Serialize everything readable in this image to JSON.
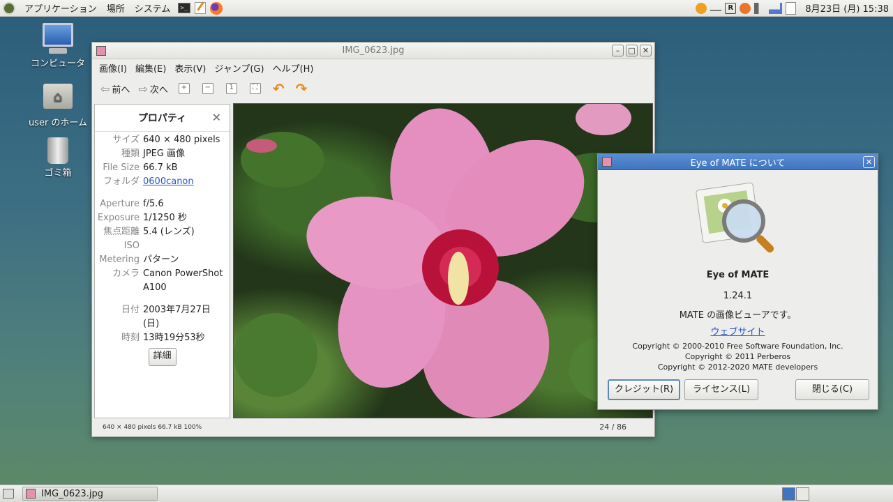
{
  "top_panel": {
    "menus": [
      "アプリケーション",
      "場所",
      "システム"
    ],
    "clock": "8月23日 (月) 15:38",
    "tray_icons": [
      "update-icon",
      "minimize-icon",
      "r-icon",
      "settings-icon",
      "volume-icon",
      "network-icon",
      "clipboard-icon"
    ]
  },
  "desktop": {
    "icons": [
      {
        "label": "コンピュータ"
      },
      {
        "label": "user のホーム"
      },
      {
        "label": "ゴミ箱"
      }
    ]
  },
  "viewer": {
    "title": "IMG_0623.jpg",
    "menu": [
      "画像(I)",
      "編集(E)",
      "表示(V)",
      "ジャンプ(G)",
      "ヘルプ(H)"
    ],
    "toolbar": {
      "prev": "前へ",
      "next": "次へ"
    },
    "sidebar": {
      "title": "プロパティ",
      "rows": [
        {
          "k": "サイズ",
          "v": "640 × 480 pixels"
        },
        {
          "k": "種類",
          "v": "JPEG 画像"
        },
        {
          "k": "File Size",
          "v": "66.7 kB"
        },
        {
          "k": "フォルダ",
          "v": "0600canon"
        },
        {
          "k": "Aperture",
          "v": "f/5.6"
        },
        {
          "k": "Exposure",
          "v": "1/1250 秒"
        },
        {
          "k": "焦点距離",
          "v": "5.4 (レンズ)"
        },
        {
          "k": "ISO",
          "v": ""
        },
        {
          "k": "Metering",
          "v": "パターン"
        },
        {
          "k": "カメラ",
          "v": "Canon PowerShot A100"
        },
        {
          "k": "日付",
          "v": "2003年7月27日 (日)"
        },
        {
          "k": "時刻",
          "v": "13時19分53秒"
        }
      ],
      "details_button": "詳細"
    },
    "status": {
      "left": "640 × 480 pixels  66.7 kB   100%",
      "right": "24 / 86"
    }
  },
  "about": {
    "title": "Eye of MATE について",
    "name": "Eye of MATE",
    "version": "1.24.1",
    "description": "MATE の画像ビューアです。",
    "website": "ウェブサイト",
    "copyright": [
      "Copyright © 2000-2010 Free Software Foundation, Inc.",
      "Copyright © 2011 Perberos",
      "Copyright © 2012-2020 MATE developers"
    ],
    "buttons": {
      "credits": "クレジット(R)",
      "license": "ライセンス(L)",
      "close": "閉じる(C)"
    }
  },
  "taskbar": {
    "task": "IMG_0623.jpg"
  },
  "colors": {
    "title_active": "#4a80c8",
    "link": "#2a55c8",
    "accent": "#e8881a"
  }
}
